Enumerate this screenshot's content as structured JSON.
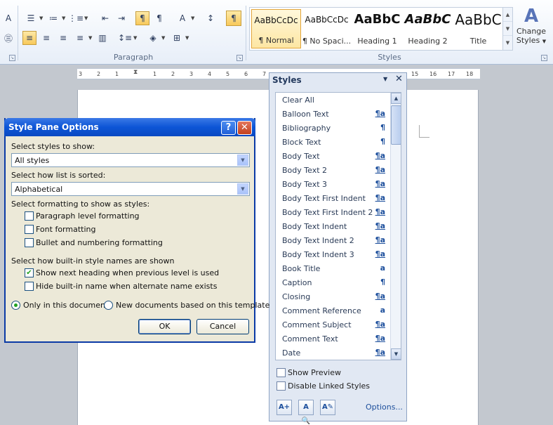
{
  "ribbon": {
    "paragraph_group_label": "Paragraph",
    "styles_group_label": "Styles",
    "gallery": [
      {
        "sample": "AaBbCcDc",
        "name": "¶ Normal",
        "selected": true
      },
      {
        "sample": "AaBbCcDc",
        "name": "¶ No Spaci...",
        "selected": false
      },
      {
        "sample": "AaBbC",
        "name": "Heading 1",
        "selected": false
      },
      {
        "sample": "AaBbC",
        "name": "Heading 2",
        "selected": false
      },
      {
        "sample": "AaBbC",
        "name": "Title",
        "selected": false
      }
    ],
    "change_styles_line1": "Change",
    "change_styles_line2": "Styles",
    "accent": "#f8c95b"
  },
  "ruler": {
    "ticks_left": [
      "3",
      "2",
      "1"
    ],
    "ticks_right": [
      "1",
      "2",
      "3",
      "4",
      "5",
      "6",
      "7"
    ],
    "ticks_far": [
      "15",
      "16",
      "17",
      "18"
    ]
  },
  "dialog": {
    "title": "Style Pane Options",
    "help_glyph": "?",
    "close_glyph": "✕",
    "show_label": "Select styles to show:",
    "show_value": "All styles",
    "sort_label": "Select how list is sorted:",
    "sort_value": "Alphabetical",
    "formatting_label": "Select formatting to show as styles:",
    "formatting_options": [
      {
        "label": "Paragraph level formatting",
        "checked": false
      },
      {
        "label": "Font formatting",
        "checked": false
      },
      {
        "label": "Bullet and numbering formatting",
        "checked": false
      }
    ],
    "builtin_label": "Select how built-in style names are shown",
    "builtin_options": [
      {
        "label": "Show next heading when previous level is used",
        "checked": true
      },
      {
        "label": "Hide built-in name when alternate name exists",
        "checked": false
      }
    ],
    "scope_options": [
      {
        "label": "Only in this document",
        "selected": true
      },
      {
        "label": "New documents based on this template",
        "selected": false
      }
    ],
    "ok_label": "OK",
    "cancel_label": "Cancel"
  },
  "styles_pane": {
    "title": "Styles",
    "items": [
      {
        "name": "Clear All",
        "glyph": "",
        "underline": false
      },
      {
        "name": "Balloon Text",
        "glyph": "¶a",
        "underline": true
      },
      {
        "name": "Bibliography",
        "glyph": "¶",
        "underline": false
      },
      {
        "name": "Block Text",
        "glyph": "¶",
        "underline": false
      },
      {
        "name": "Body Text",
        "glyph": "¶a",
        "underline": true
      },
      {
        "name": "Body Text 2",
        "glyph": "¶a",
        "underline": true
      },
      {
        "name": "Body Text 3",
        "glyph": "¶a",
        "underline": true
      },
      {
        "name": "Body Text First Indent",
        "glyph": "¶a",
        "underline": true
      },
      {
        "name": "Body Text First Indent 2",
        "glyph": "¶a",
        "underline": true
      },
      {
        "name": "Body Text Indent",
        "glyph": "¶a",
        "underline": true
      },
      {
        "name": "Body Text Indent 2",
        "glyph": "¶a",
        "underline": true
      },
      {
        "name": "Body Text Indent 3",
        "glyph": "¶a",
        "underline": true
      },
      {
        "name": "Book Title",
        "glyph": "a",
        "underline": false
      },
      {
        "name": "Caption",
        "glyph": "¶",
        "underline": false
      },
      {
        "name": "Closing",
        "glyph": "¶a",
        "underline": true
      },
      {
        "name": "Comment Reference",
        "glyph": "a",
        "underline": false
      },
      {
        "name": "Comment Subject",
        "glyph": "¶a",
        "underline": true
      },
      {
        "name": "Comment Text",
        "glyph": "¶a",
        "underline": true
      },
      {
        "name": "Date",
        "glyph": "¶a",
        "underline": true
      }
    ],
    "show_preview_label": "Show Preview",
    "disable_linked_label": "Disable Linked Styles",
    "options_label": "Options..."
  }
}
